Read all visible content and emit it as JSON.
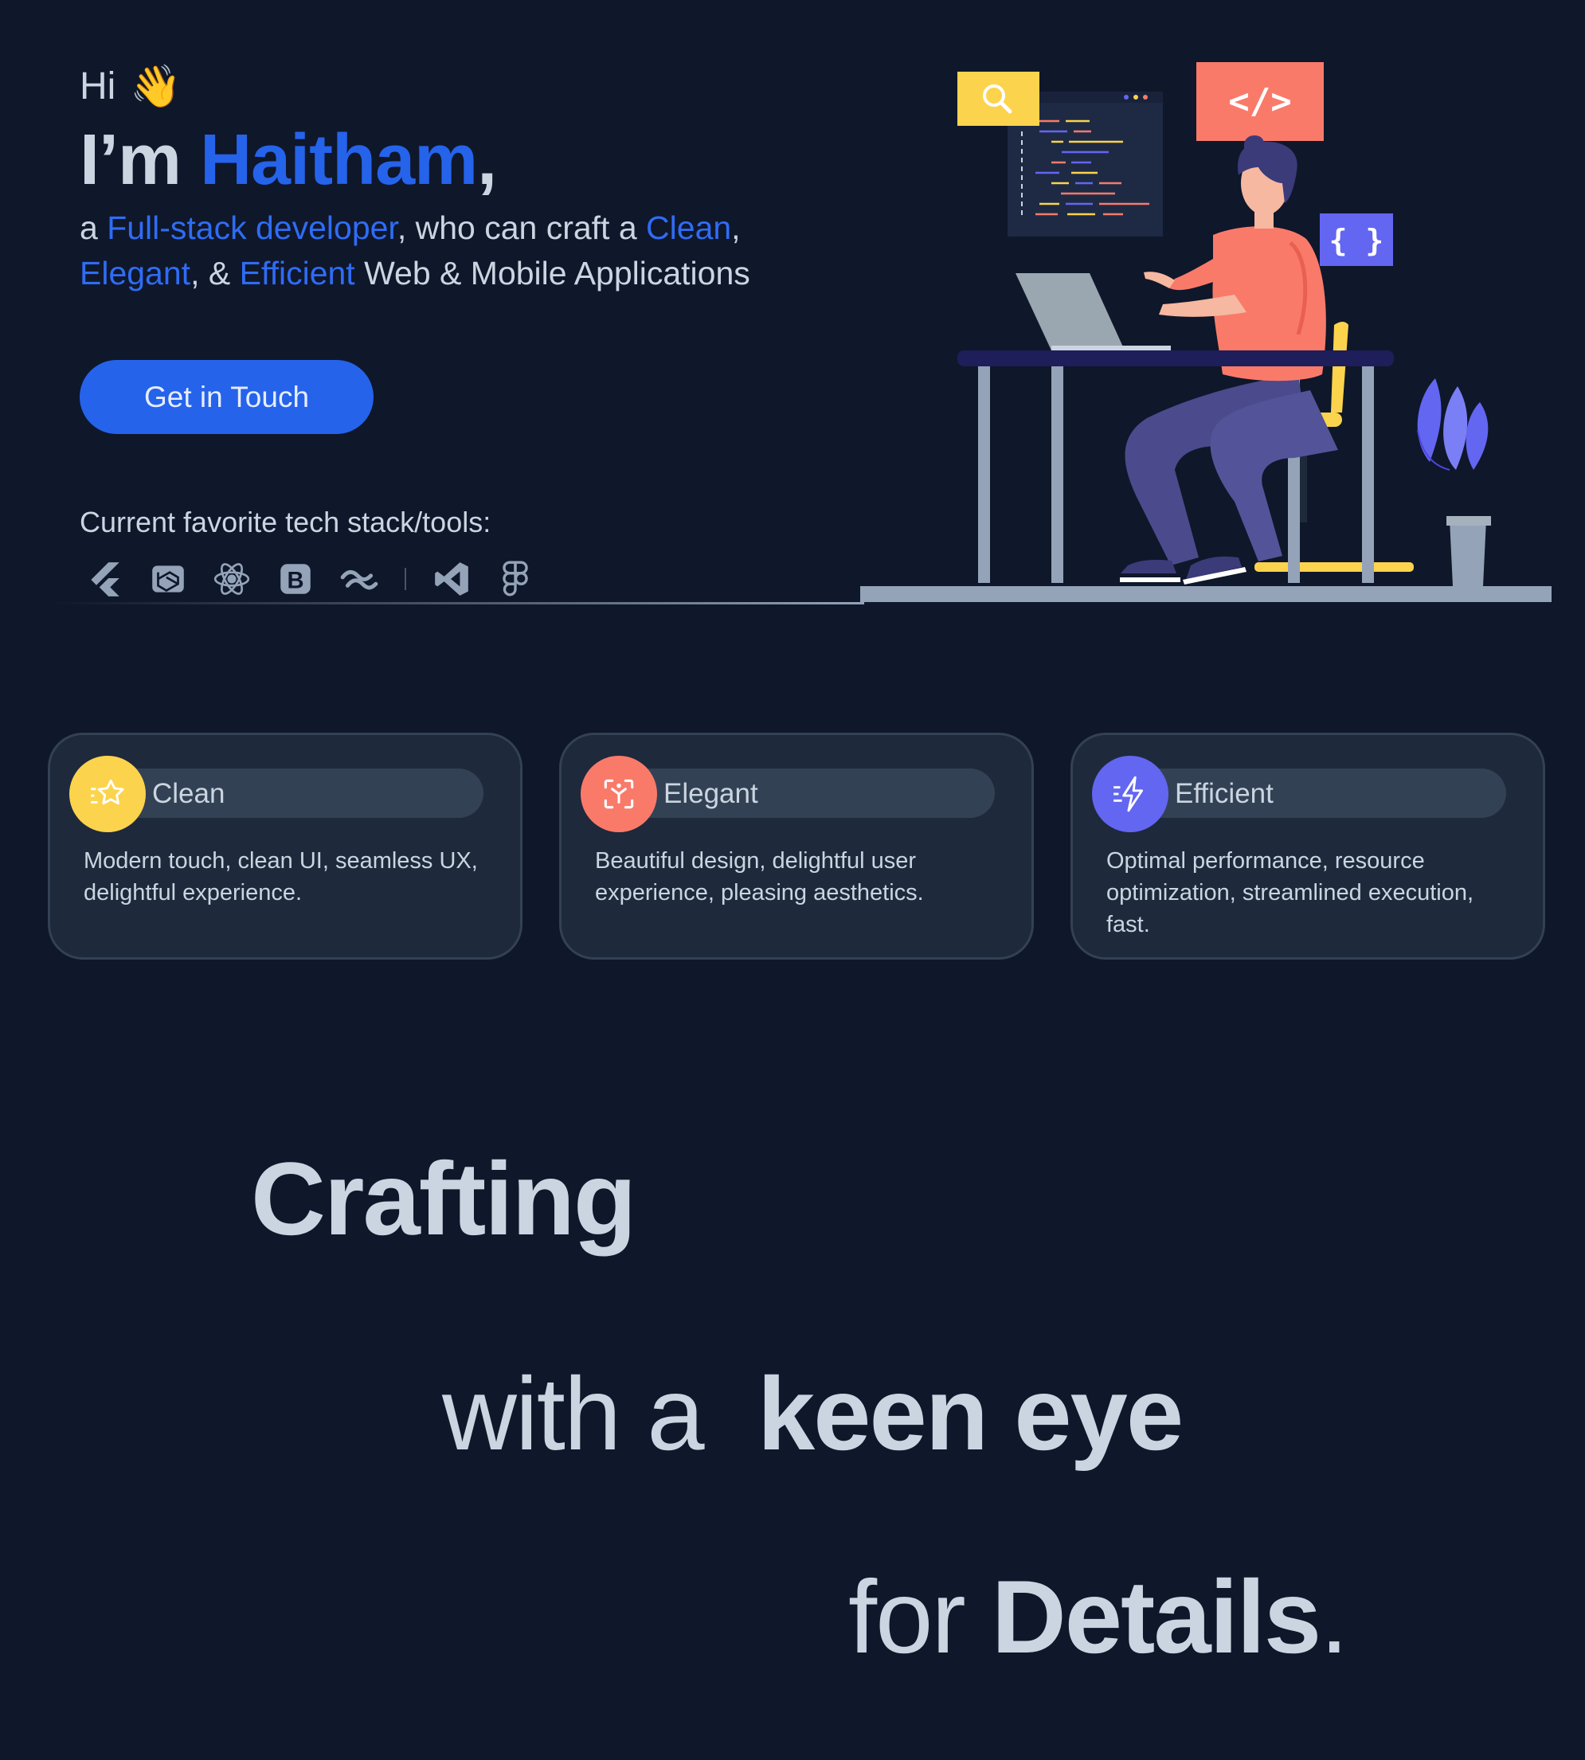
{
  "hero": {
    "greeting": "Hi",
    "wave_emoji": "👋",
    "intro_prefix": "I’m",
    "name": "Haitham",
    "intro_suffix": ",",
    "tagline": {
      "t1": "a ",
      "role": "Full-stack developer",
      "t2": ", who can craft a ",
      "q1": "Clean",
      "t3": ",",
      "q2": "Elegant",
      "t4": ", & ",
      "q3": "Efficient",
      "t5": " Web & Mobile Applications"
    },
    "cta_label": "Get in Touch",
    "stack_label": "Current favorite tech stack/tools:",
    "tools": [
      "flutter-icon",
      "laravel-icon",
      "react-icon",
      "bootstrap-icon",
      "tailwind-icon",
      "vscode-icon",
      "figma-icon"
    ],
    "illustration_code_tag": "</>",
    "illustration_braces": "{ }"
  },
  "cards": [
    {
      "title": "Clean",
      "desc": "Modern touch, clean UI, seamless UX, delightful experience.",
      "icon": "star-sparkle-icon",
      "color": "#fcd34d"
    },
    {
      "title": "Elegant",
      "desc": "Beautiful design, delightful user experience, pleasing aesthetics.",
      "icon": "focus-frame-icon",
      "color": "#fa7a6a"
    },
    {
      "title": "Efficient",
      "desc": "Optimal performance, resource optimization, streamlined execution, fast.",
      "icon": "bolt-speed-icon",
      "color": "#6366f1"
    }
  ],
  "statement": {
    "line1": "Crafting",
    "line2_prefix": "with a",
    "line2_bold": "keen eye",
    "line3_prefix": "for",
    "line3_bold": "Details",
    "line3_suffix": "."
  },
  "colors": {
    "background": "#0f172a",
    "accent": "#2563eb",
    "text": "#cbd5e1",
    "card": "#1e293b"
  }
}
